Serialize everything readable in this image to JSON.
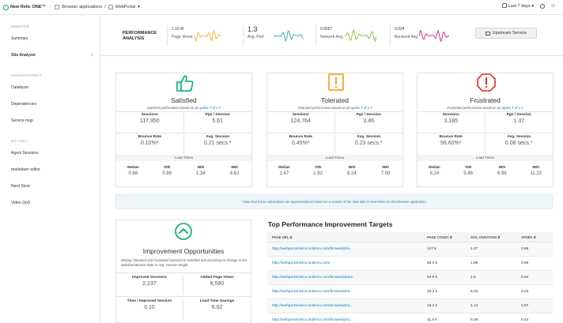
{
  "topbar": {
    "brand": "New Relic ONE™",
    "crumb1": "Browser applications",
    "crumb2": "WebPortal",
    "time_label": "Last 7 days",
    "colors": {
      "brand": "#00ac69"
    }
  },
  "sidebar": {
    "sections": [
      {
        "title": "MONITOR",
        "items": [
          {
            "label": "Summary"
          },
          {
            "label": "Site Analyzer"
          }
        ]
      },
      {
        "title": "INSIGHTS/RECT",
        "items": [
          {
            "label": "Dataliyzer"
          },
          {
            "label": "Dependencies"
          },
          {
            "label": "Service map"
          }
        ]
      },
      {
        "title": "MY ONLY",
        "items": [
          {
            "label": "Agent Sessions"
          },
          {
            "label": "markdown editor"
          },
          {
            "label": "Nerd Store"
          },
          {
            "label": "Video QoS"
          }
        ]
      }
    ]
  },
  "header": {
    "title_line1": "PERFORMANCE",
    "title_line2": "ANALYSIS",
    "metrics": [
      {
        "value": "1.16 M",
        "label": "Page Views",
        "color": "#f4b740"
      },
      {
        "value": "1.3",
        "label": "Avg. Perf.",
        "color": "#3fb1a6"
      },
      {
        "value": "0.0657",
        "label": "Network Avg.",
        "color": "#8cc63f"
      },
      {
        "value": "0.024",
        "label": "Backend Avg.",
        "color": "#d63384"
      }
    ],
    "upstream_label": "Upstream Service"
  },
  "cards": [
    {
      "title": "Satisfied",
      "desc_prefix": "Satisfied performance based on an",
      "desc_link": "apdex T of 1.7",
      "sessions_label": "Sessions",
      "sessions": "117,950",
      "pgs_label": "Pgs / Session",
      "pgs": "5.61",
      "bounce_label": "Bounce Rate",
      "bounce": "0.10%*",
      "avg_label": "Avg. Session",
      "avg": "0.21 secs.*",
      "load_label": "Load Times",
      "loads": [
        {
          "label": "Median",
          "value": "0.68"
        },
        {
          "label": "75th",
          "value": "0.98"
        },
        {
          "label": "95th",
          "value": "1.34"
        },
        {
          "label": "99th",
          "value": "4.62"
        }
      ],
      "color": "#00ac69"
    },
    {
      "title": "Tolerated",
      "desc_prefix": "Tolerated performance based on an",
      "desc_link": "apdex T of 1.7",
      "sessions_label": "Sessions",
      "sessions": "124,764",
      "pgs_label": "Pgs / Session",
      "pgs": "3.46",
      "bounce_label": "Bounce Rate",
      "bounce": "0.45%*",
      "avg_label": "Avg. Session",
      "avg": "0.23 secs.*",
      "load_label": "Load Times",
      "loads": [
        {
          "label": "Median",
          "value": "1.47"
        },
        {
          "label": "75th",
          "value": "1.92"
        },
        {
          "label": "95th",
          "value": "6.24"
        },
        {
          "label": "99th",
          "value": "7.00"
        }
      ],
      "color": "#f4a522"
    },
    {
      "title": "Frustrated",
      "desc_prefix": "Frustrated performance based on an",
      "desc_link": "apdex T of 1.7",
      "sessions_label": "Sessions",
      "sessions": "3,185",
      "pgs_label": "Pgs / Session",
      "pgs": "1.37",
      "bounce_label": "Bounce Rate",
      "bounce": "56.60%*",
      "avg_label": "Avg. Session",
      "avg": "0.08 secs.*",
      "load_label": "Load Times",
      "loads": [
        {
          "label": "Median",
          "value": "5.24"
        },
        {
          "label": "75th",
          "value": "5.46"
        },
        {
          "label": "95th",
          "value": "6.96"
        },
        {
          "label": "99th",
          "value": "11.23"
        }
      ],
      "color": "#df2d24"
    }
  ],
  "note": "* Note that these calculations are approximations based on a sample of the total data in New Relic for this Browser application.",
  "improvement": {
    "title": "Improvement Opportunities",
    "desc": "Moving Tolerated and Frustrated sessions to Satisfied and assuming no change in the Satisfied Bounce Rate or Avg. Session length.",
    "improved_label": "Improved Sessions",
    "improved": "2,237",
    "added_label": "Added Page Views",
    "added": "8,580",
    "time_label": "Time / Improved Session",
    "time": "0.10",
    "savings_label": "Load Time Savings",
    "savings": "6.02",
    "color": "#00ac69"
  },
  "targets": {
    "title": "Top Performance Improvement Targets",
    "columns": [
      "PAGE URL",
      "PAGE COUNT",
      "AVG. DURATION",
      "APDEX"
    ],
    "rows": [
      {
        "url": "http://webportal.telco.nrdemo.com/browse/pho...",
        "count": "147 k",
        "dur": "1.27",
        "apdex": "0.86"
      },
      {
        "url": "http://webportal.telco.nrdemo.com/",
        "count": "98.3 k",
        "dur": "1.88",
        "apdex": "0.59"
      },
      {
        "url": "http://webportal.telco.nrdemo.com/browse/plans",
        "count": "94.9 k",
        "dur": "1.6",
        "apdex": "0.94"
      },
      {
        "url": "http://webportal.telco.nrdemo.com/browse/pho...",
        "count": "33.3 k",
        "dur": "6.02",
        "apdex": "0.43"
      },
      {
        "url": "http://webportal.telco.nrdemo.com/browse/pho...",
        "count": "18.2 k",
        "dur": "1.13",
        "apdex": "0.97"
      },
      {
        "url": "http://webportal.telco.nrdemo.com/browse/pho...",
        "count": "11.8 k",
        "dur": "6.06",
        "apdex": "0.42"
      }
    ]
  }
}
